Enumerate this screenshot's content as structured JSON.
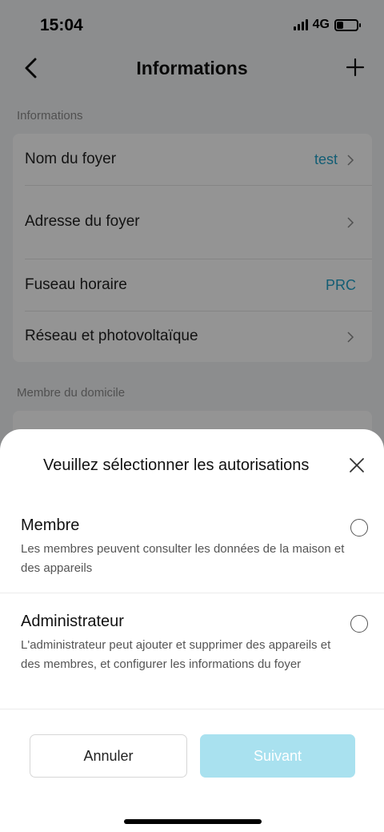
{
  "status_bar": {
    "time": "15:04",
    "network": "4G",
    "battery_level": 0.35
  },
  "nav": {
    "title": "Informations",
    "back_icon": "chevron-left-icon",
    "add_icon": "plus-icon"
  },
  "info_section": {
    "label": "Informations",
    "rows": [
      {
        "label": "Nom du foyer",
        "value": "test",
        "chevron": true
      },
      {
        "label": "Adresse du foyer",
        "value": "",
        "chevron": true
      },
      {
        "label": "Fuseau horaire",
        "value": "PRC",
        "chevron": false
      },
      {
        "label": "Réseau et photovoltaïque",
        "value": "",
        "chevron": true
      }
    ]
  },
  "members_section": {
    "label": "Membre du domicile"
  },
  "sheet": {
    "title": "Veuillez sélectionner les autorisations",
    "options": [
      {
        "title": "Membre",
        "description": "Les membres peuvent consulter les données de la maison et des appareils",
        "selected": false
      },
      {
        "title": "Administrateur",
        "description": "L'administrateur peut ajouter et supprimer des appareils et des membres, et configurer les informations du foyer",
        "selected": false
      }
    ],
    "cancel_label": "Annuler",
    "next_label": "Suivant"
  },
  "colors": {
    "accent": "#20a0c8",
    "next_disabled": "#a9e1ef"
  }
}
